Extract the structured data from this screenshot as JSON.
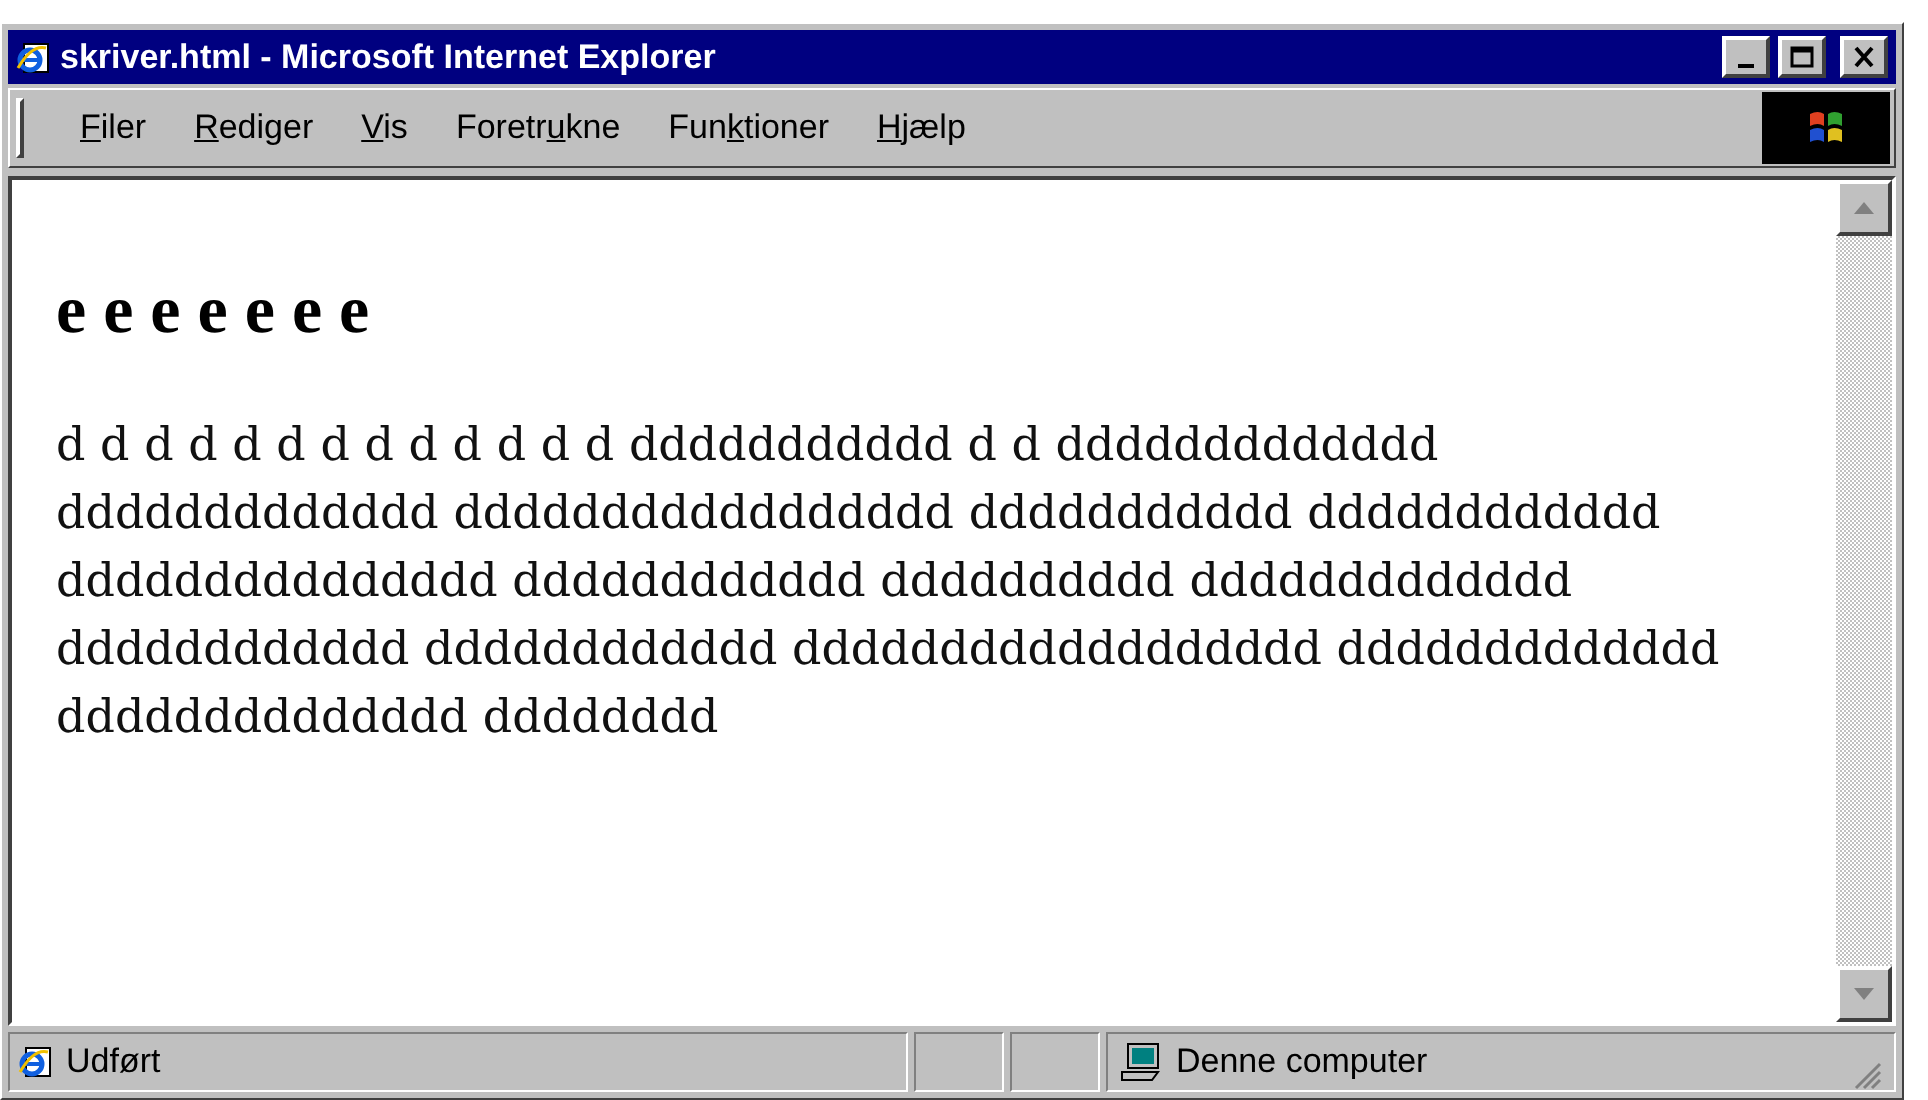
{
  "window": {
    "title": "skriver.html - Microsoft Internet Explorer"
  },
  "menu": [
    {
      "key": "F",
      "after": "iler"
    },
    {
      "key": "R",
      "after": "ediger"
    },
    {
      "key": "V",
      "after": "is"
    },
    {
      "before": "Foretr",
      "key": "u",
      "after": "kne"
    },
    {
      "before": "Fun",
      "key": "k",
      "after": "tioner"
    },
    {
      "key": "H",
      "after": "jælp"
    }
  ],
  "page": {
    "heading": "e e e e e e e",
    "paragraph": "d d d d d d d d d d d d d ddddddddddd d d ddddddddddddd ddddddddddddd ddddddddddddddddd ddddddddddd dddddddddddd ddddddddddddddd dddddddddddd dddddddddd ddddddddddddd dddddddddddd dddddddddddd dddddddddddddddddd ddddddddddddd dddddddddddddd dddddddd"
  },
  "status_bar": {
    "text": "Udført",
    "zone": "Denne computer"
  }
}
